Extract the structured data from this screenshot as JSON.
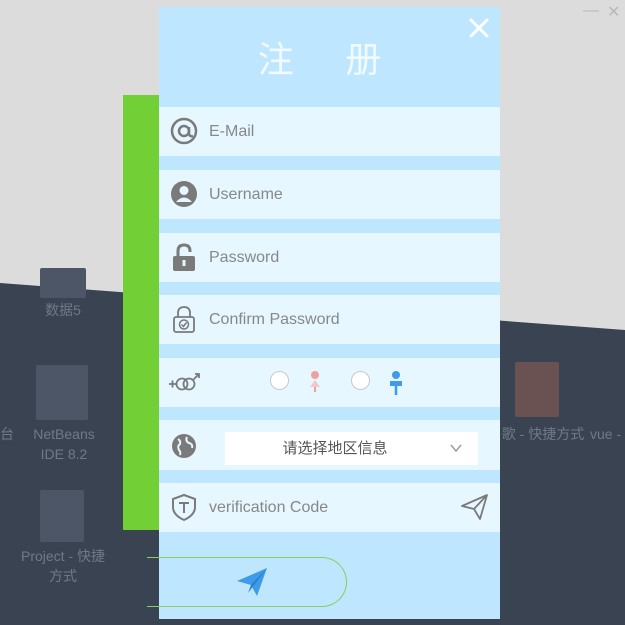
{
  "window": {
    "minimize_glyph": "—",
    "close_glyph": "✕"
  },
  "desktop": {
    "icons": [
      {
        "label": "数据5"
      },
      {
        "label": "NetBeans IDE 8.2"
      },
      {
        "label": "Project - 快捷方式"
      },
      {
        "label": "台"
      },
      {
        "label": "歌 - 快捷方式"
      },
      {
        "label": "vue -"
      }
    ]
  },
  "form": {
    "title": "注 册",
    "email": {
      "placeholder": "E-Mail",
      "icon": "at-icon"
    },
    "username": {
      "placeholder": "Username",
      "icon": "user-icon"
    },
    "password": {
      "placeholder": "Password",
      "icon": "lock-icon"
    },
    "confirm_password": {
      "placeholder": "Confirm Password",
      "icon": "lock-check-icon"
    },
    "gender": {
      "icon": "gender-icon",
      "options": [
        "female",
        "male"
      ]
    },
    "region": {
      "label": "请选择地区信息",
      "icon": "globe-icon"
    },
    "verification": {
      "placeholder": "verification Code",
      "icon": "shield-icon"
    },
    "colors": {
      "panel": "#bfe6ff",
      "row": "#e6f7ff",
      "icon": "#7a7a7a",
      "female": "#f0a0a0",
      "male": "#3d9be9",
      "submit_border": "#84d15c"
    }
  }
}
